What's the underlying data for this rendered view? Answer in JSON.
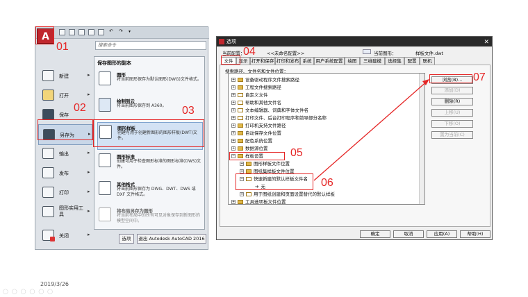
{
  "left_menu": {
    "search_placeholder": "搜索命令",
    "left_items": [
      {
        "label": "新建"
      },
      {
        "label": "打开"
      },
      {
        "label": "保存"
      },
      {
        "label": "另存为"
      },
      {
        "label": "输出"
      },
      {
        "label": "发布"
      },
      {
        "label": "打印"
      },
      {
        "label": "图形实用工具"
      },
      {
        "label": "关闭"
      }
    ],
    "panel_title": "保存图形的副本",
    "panel_items": [
      {
        "title": "图形",
        "desc": "将当前图形保存为默认图形(DWG)文件格式。"
      },
      {
        "title": "绘制到云",
        "desc": "将当前图形保存到 A360。"
      },
      {
        "title": "图形样板",
        "desc": "创建可用于创建新图形的图形样板(DWT)文件。"
      },
      {
        "title": "图形标准",
        "desc": "创建可用于检查图形标准的图形标准(DWS)文件。"
      },
      {
        "title": "其他格式",
        "desc": "将当前图形保存为 DWG、DWT、DWS 或 DXF 文件格式。"
      },
      {
        "title": "将布局另存为图形",
        "desc": "将当前布局中的所有可见对象保存到新图形的模型空间中。"
      }
    ],
    "options_button": "选项",
    "exit_button": "退出 Autodesk AutoCAD 2016"
  },
  "dialog": {
    "title": "选项",
    "current_profile_label": "当前配置：",
    "current_profile_value": "<<未命名配置>>",
    "current_drawing_label": "当前图形：",
    "current_drawing_value": "样板文件.dwt",
    "tabs": [
      "文件",
      "显示",
      "打开和保存",
      "打印和发布",
      "系统",
      "用户系统配置",
      "绘图",
      "三维建模",
      "选择集",
      "配置",
      "联机"
    ],
    "tree_heading": "搜索路径、文件名和文件位置：",
    "tree_items": [
      {
        "label": "设备驱动程序文件搜索路径",
        "level": 0,
        "toggle": "+"
      },
      {
        "label": "工程文件搜索路径",
        "level": 0,
        "toggle": "+"
      },
      {
        "label": "自定义文件",
        "level": 0,
        "toggle": "+"
      },
      {
        "label": "帮助和其他文件名",
        "level": 0,
        "toggle": "+"
      },
      {
        "label": "文本编辑器、词典和字体文件名",
        "level": 0,
        "toggle": "+"
      },
      {
        "label": "打印文件、后台打印程序和前导部分名称",
        "level": 0,
        "toggle": "+"
      },
      {
        "label": "打印机支持文件路径",
        "level": 0,
        "toggle": "+"
      },
      {
        "label": "自动保存文件位置",
        "level": 0,
        "toggle": "+"
      },
      {
        "label": "配色系统位置",
        "level": 0,
        "toggle": "+"
      },
      {
        "label": "数据源位置",
        "level": 0,
        "toggle": "+"
      },
      {
        "label": "样板设置",
        "level": 0,
        "toggle": "-"
      },
      {
        "label": "图形样板文件位置",
        "level": 1,
        "toggle": "+"
      },
      {
        "label": "图纸集样板文件位置",
        "level": 1,
        "toggle": "+"
      },
      {
        "label": "快速新建的默认样板文件名",
        "level": 1,
        "toggle": "-"
      },
      {
        "label": "无",
        "level": 2,
        "toggle": ""
      },
      {
        "label": "用于图纸创建和页面设置替代的默认样板",
        "level": 1,
        "toggle": "+"
      },
      {
        "label": "工具选项板文件位置",
        "level": 0,
        "toggle": "+"
      }
    ],
    "side_buttons": [
      {
        "label": "浏览(B)...",
        "enabled": true
      },
      {
        "label": "添加(D)",
        "enabled": false
      },
      {
        "label": "删除(R)",
        "enabled": true
      },
      {
        "label": "上移(U)",
        "enabled": false
      },
      {
        "label": "下移(O)",
        "enabled": false
      },
      {
        "label": "置为当前(C)",
        "enabled": false
      }
    ],
    "bottom_buttons": [
      "确定",
      "取消",
      "应用(A)",
      "帮助(H)"
    ]
  },
  "annotations": [
    "01",
    "02",
    "03",
    "04",
    "05",
    "06",
    "07"
  ],
  "date": "2019/3/26",
  "colors": {
    "annotation_red": "#e52626",
    "accent_blue": "#3b7ed0",
    "autocad_red": "#c0262d"
  }
}
